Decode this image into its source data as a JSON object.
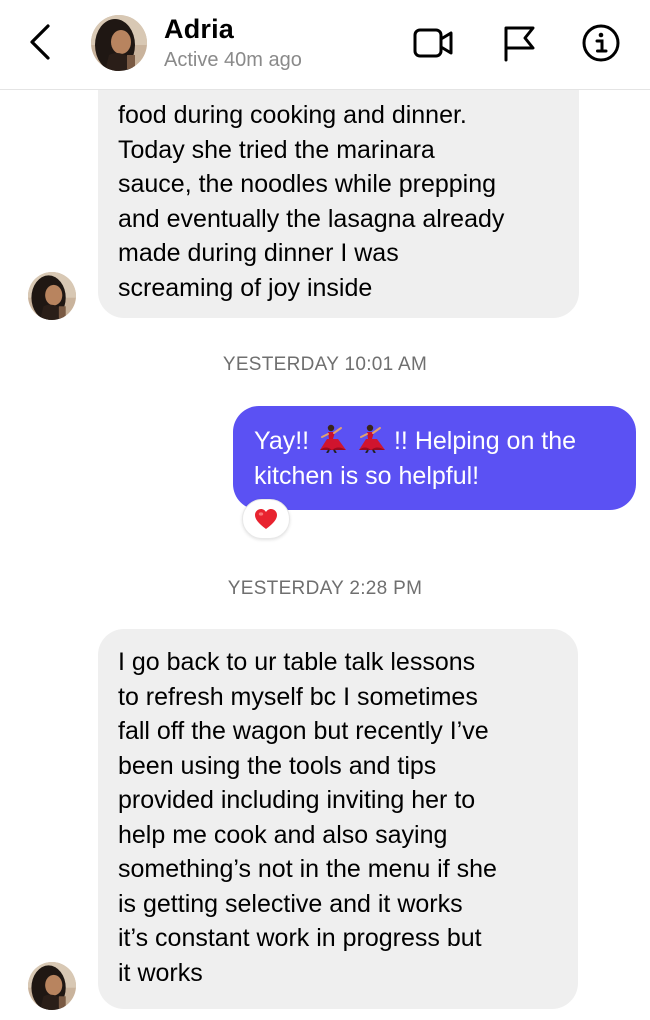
{
  "header": {
    "back_icon": "chevron-left-icon",
    "contact_name": "Adria",
    "status": "Active 40m ago",
    "icons": [
      "video-camera-icon",
      "flag-icon",
      "info-icon"
    ]
  },
  "messages": [
    {
      "direction": "incoming",
      "lines": [
        "food during cooking and dinner.",
        "Today she tried the marinara",
        "sauce, the noodles while prepping",
        "and eventually the lasagna already",
        "made during dinner I was",
        "screaming of joy inside"
      ]
    },
    {
      "timestamp": "YESTERDAY 10:01 AM"
    },
    {
      "direction": "outgoing",
      "line1_start": "Yay!!",
      "line1_emoji": "dancer-emoji",
      "line1_end": "!! Helping on the",
      "line2": "kitchen is so helpful!",
      "reaction": "❤️"
    },
    {
      "timestamp": "YESTERDAY 2:28 PM"
    },
    {
      "direction": "incoming",
      "lines": [
        "I go back to ur table talk lessons",
        "to refresh myself bc I sometimes",
        "fall off the wagon but recently I’ve",
        "been using the tools and tips",
        "provided including inviting her to",
        "help me cook and also saying",
        "something’s not in the menu if she",
        "is getting selective and it works",
        "it’s constant work in progress but",
        "it works"
      ]
    }
  ],
  "colors": {
    "outgoing_bubble": "#5b51f3",
    "incoming_bubble": "#efefef",
    "timestamp_text": "#6f6f6f",
    "status_text": "#8a8a8a"
  }
}
